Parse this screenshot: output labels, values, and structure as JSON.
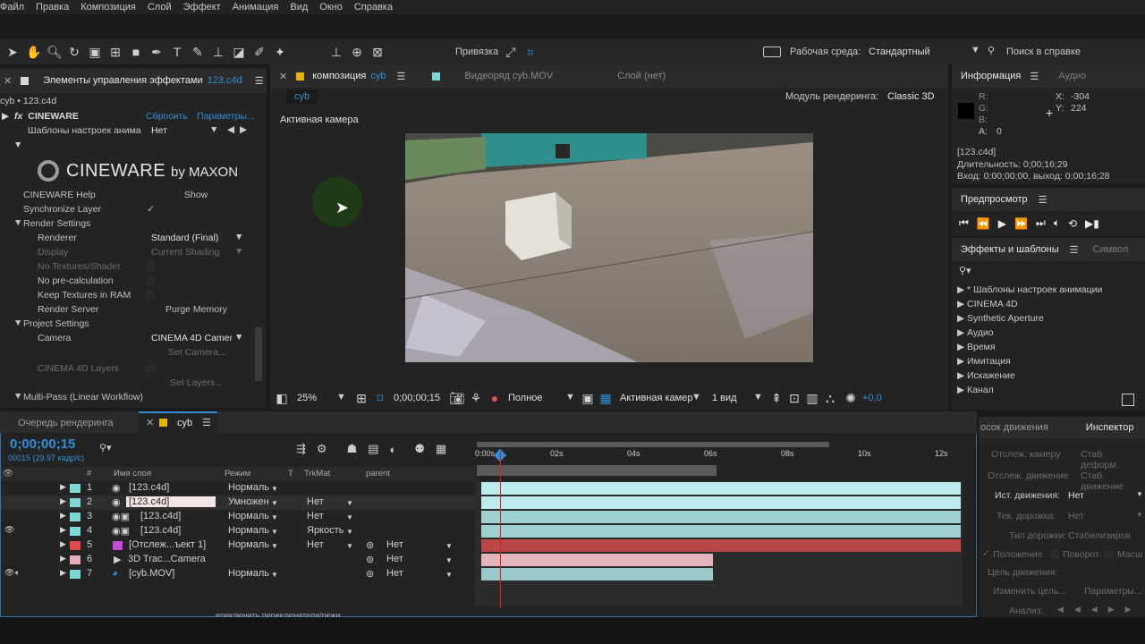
{
  "menu": [
    "Файл",
    "Правка",
    "Композиция",
    "Слой",
    "Эффект",
    "Анимация",
    "Вид",
    "Окно",
    "Справка"
  ],
  "toolbar": {
    "snapping_label": "Привязка",
    "workspace_label": "Рабочая среда:",
    "workspace_value": "Стандартный",
    "search_help": "Поиск в справке"
  },
  "effects_panel": {
    "title": "Элементы управления эффектами",
    "title_file": "123.c4d",
    "breadcrumb": "cyb • 123.c4d",
    "effect_name": "CINEWARE",
    "reset": "Сбросить",
    "params": "Параметры...",
    "preset_label": "Шаблоны настроек анима",
    "preset_value": "Нет",
    "logo_main": "CINEWARE",
    "logo_by": "by MAXON",
    "props": [
      {
        "key": "CINEWARE Help",
        "value": "Show"
      },
      {
        "key": "Synchronize Layer",
        "value": "✓"
      },
      {
        "key": "Render Settings",
        "value": ""
      },
      {
        "key": "Renderer",
        "value": "Standard (Final)"
      },
      {
        "key": "Display",
        "value": "Current Shading"
      },
      {
        "key": "No Textures/Shader",
        "value": ""
      },
      {
        "key": "No pre-calculation",
        "value": ""
      },
      {
        "key": "Keep Textures in RAM",
        "value": ""
      },
      {
        "key": "Render Server",
        "value": "Purge Memory"
      },
      {
        "key": "Project Settings",
        "value": ""
      },
      {
        "key": "Camera",
        "value": "CINEMA 4D Camera"
      },
      {
        "key": "",
        "value": "Set Camera..."
      },
      {
        "key": "CINEMA 4D Layers",
        "value": ""
      },
      {
        "key": "",
        "value": "Set Layers..."
      },
      {
        "key": "Multi-Pass (Linear Workflow)",
        "value": ""
      }
    ]
  },
  "comp_panel": {
    "tab_comp": "композиция",
    "tab_comp_name": "cyb",
    "tab_footage": "Видеоряд cyb.MOV",
    "tab_layer": "Слой (нет)",
    "sub_tab": "cyb",
    "render_module_label": "Модуль рендеринга:",
    "render_module_value": "Classic 3D",
    "camera_label": "Активная камера",
    "zoom": "25%",
    "timecode": "0;00;00;15",
    "quality": "Полное",
    "view_camera": "Активная камер",
    "views": "1 вид",
    "exposure": "+0,0"
  },
  "info_panel": {
    "tab_info": "Информация",
    "tab_audio": "Аудио",
    "r": "R:",
    "g": "G:",
    "b": "B:",
    "a": "A:",
    "a_val": "0",
    "x": "X:",
    "x_val": "-304",
    "y": "Y:",
    "y_val": "224",
    "file": "[123.c4d]",
    "duration": "Длительность: 0;00;16;29",
    "inout": "Вход: 0;00;00;00, выход: 0;00;16;28"
  },
  "preview_panel": {
    "title": "Предпросмотр"
  },
  "effects_presets": {
    "tab": "Эффекты и шаблоны",
    "tab2": "Символ",
    "items": [
      "* Шаблоны настроек анимации",
      "CINEMA 4D",
      "Synthetic Aperture",
      "Аудио",
      "Время",
      "Имитация",
      "Искажение",
      "Канал"
    ]
  },
  "timeline": {
    "tab_render": "Очередь рендеринга",
    "tab_comp": "cyb",
    "timecode": "0;00;00;15",
    "fps": "00015 (29.97 кадр/с)",
    "col_name": "Имя слоя",
    "col_mode": "Режим",
    "col_t": "T",
    "col_trkmat": "TrkMat",
    "col_parent": "parent",
    "ruler": [
      "0:00s",
      "02s",
      "04s",
      "06s",
      "08s",
      "10s",
      "12s"
    ],
    "layers": [
      {
        "num": "1",
        "name": "[123.c4d]",
        "mode": "Нормаль",
        "trk": "",
        "parent": "",
        "color": "#7fd6d9"
      },
      {
        "num": "2",
        "name": "[123.c4d]",
        "mode": "Умножен",
        "trk": "Нет",
        "parent": "",
        "color": "#7fd6d9"
      },
      {
        "num": "3",
        "name": "[123.c4d]",
        "mode": "Нормаль",
        "trk": "Нет",
        "parent": "",
        "color": "#7fd6d9"
      },
      {
        "num": "4",
        "name": "[123.c4d]",
        "mode": "Нормаль",
        "trk": "Яркость",
        "parent": "",
        "color": "#7fd6d9"
      },
      {
        "num": "5",
        "name": "[Отслеж...ъект 1]",
        "mode": "Нормаль",
        "trk": "Нет",
        "parent": "Нет",
        "color": "#e24a4a"
      },
      {
        "num": "6",
        "name": "3D Trac...Camera",
        "mode": "",
        "trk": "",
        "parent": "Нет",
        "color": "#e6aeb8"
      },
      {
        "num": "7",
        "name": "[cyb.MOV]",
        "mode": "Нормаль",
        "trk": "",
        "parent": "Нет",
        "color": "#7fd6d9"
      }
    ],
    "footer": "ереключить переключатели/режи"
  },
  "inspector": {
    "tab1": "осок движения",
    "tab2": "Инспектор",
    "rows": [
      {
        "a": "Отслеж. камеру",
        "b": "Стаб. деформ."
      },
      {
        "a": "Отслеж. движение",
        "b": "Стаб. движение"
      },
      {
        "a": "Ист. движения:",
        "b": "Нет"
      },
      {
        "a": "Тек. дорожка:",
        "b": "Нет"
      },
      {
        "a": "Тип дорожки:",
        "b": "Стабилизиров"
      },
      {
        "a": "Положение",
        "b": "Поворот",
        "c": "Масш"
      },
      {
        "a": "Цель движения:",
        "b": ""
      },
      {
        "a": "Изменить цель...",
        "b": "Параметры..."
      },
      {
        "a": "Анализ:",
        "b": ""
      }
    ]
  }
}
